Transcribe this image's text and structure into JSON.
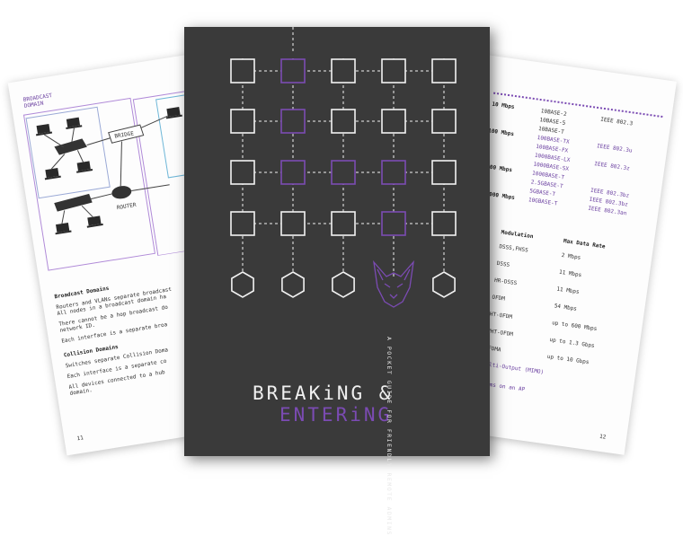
{
  "colors": {
    "cover": "#3a3a3a",
    "accent": "#7b4bb3",
    "white_line": "#f2f2f2"
  },
  "cover": {
    "title_line1": "BREAKiNG &",
    "title_line2": "ENTERiNG",
    "subtitle": "A POCKET GUIDE FOR FRIENDLY REMOTE ADMINS",
    "logo_icon": "cat-face-icon"
  },
  "left_page": {
    "header": [
      "BROADCAST",
      "DOMAIN"
    ],
    "bridge_label": "BRIDGE",
    "router_label": "ROUTER",
    "section1_title": "Broadcast Domains",
    "section1_lines": [
      "Routers and VLANs separate broadcast",
      "All nodes in a broadcast domain ha",
      "There cannot be a hop broadcast do",
      "network ID.",
      "Each interface is a separate broa"
    ],
    "section2_title": "Collision Domains",
    "section2_lines": [
      "Switches separate Collision Doma",
      "Each interface is a separate co",
      "All devices connected to a hub",
      "domain."
    ],
    "page_number": "11"
  },
  "right_page": {
    "speed_rows": [
      [
        "10 Mbps",
        "10BASE-2",
        "IEEE 802.3"
      ],
      [
        "",
        "10BASE-5",
        ""
      ],
      [
        "",
        "10BASE-T",
        ""
      ],
      [
        "100 Mbps",
        "100BASE-TX",
        "IEEE 802.3u"
      ],
      [
        "",
        "100BASE-FX",
        ""
      ],
      [
        "",
        "1000BASE-LX",
        "IEEE 802.3z"
      ],
      [
        "",
        "1000BASE-SX",
        ""
      ],
      [
        "1000 Mbps",
        "1000BASE-T",
        ""
      ],
      [
        "",
        "2.5GBASE-T",
        "IEEE 802.3bz"
      ],
      [
        "",
        "5GBASE-T",
        "IEEE 802.3bz"
      ],
      [
        "10,000 Mbps",
        "10GBASE-T",
        "IEEE 802.3an"
      ]
    ],
    "table_title": "nts",
    "table_header": [
      "Modulation",
      "Max Data Rate"
    ],
    "table_rows": [
      [
        "DSSS,FHSS",
        "2 Mbps"
      ],
      [
        "DSSS",
        "11 Mbps"
      ],
      [
        "HR-DSSS",
        "11 Mbps"
      ],
      [
        "OFDM",
        "54 Mbps"
      ],
      [
        "HT-OFDM",
        "up to 600 Mbps"
      ],
      [
        "VHT-OFDM",
        "up to 1.3 Gbps"
      ],
      [
        "OFDMA",
        "up to 10 Gbps"
      ]
    ],
    "note1": "Multi-Output (MIMO)",
    "note2": "reams on an AP",
    "page_number": "12"
  }
}
